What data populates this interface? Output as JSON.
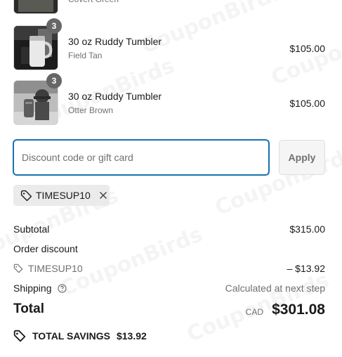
{
  "watermark": "CouponBirds",
  "cart": {
    "items": [
      {
        "name": "",
        "variant": "Covert Green",
        "price": "",
        "quantity": ""
      },
      {
        "name": "30 oz Ruddy Tumbler",
        "variant": "Field Tan",
        "price": "$105.00",
        "quantity": "3"
      },
      {
        "name": "30 oz Ruddy Tumbler",
        "variant": "Otter Brown",
        "price": "$105.00",
        "quantity": "3"
      }
    ]
  },
  "discount": {
    "placeholder": "Discount code or gift card",
    "value": "",
    "apply_label": "Apply",
    "applied_code": "TIMESUP10"
  },
  "summary": {
    "subtotal_label": "Subtotal",
    "subtotal_value": "$315.00",
    "order_discount_label": "Order discount",
    "discount_code": "TIMESUP10",
    "discount_value": "– $13.92",
    "shipping_label": "Shipping",
    "shipping_value": "Calculated at next step",
    "total_label": "Total",
    "currency": "CAD",
    "total_value": "$301.08",
    "savings_label": "TOTAL SAVINGS",
    "savings_value": "$13.92"
  },
  "icons": {
    "tag": "tag-icon",
    "close": "close-icon",
    "help": "help-circle-icon",
    "savings": "savings-tag-icon"
  },
  "colors": {
    "focus_border": "#1773b0",
    "muted_text": "#707070",
    "quantity_badge": "#666666",
    "chip_background": "#ebebeb"
  }
}
